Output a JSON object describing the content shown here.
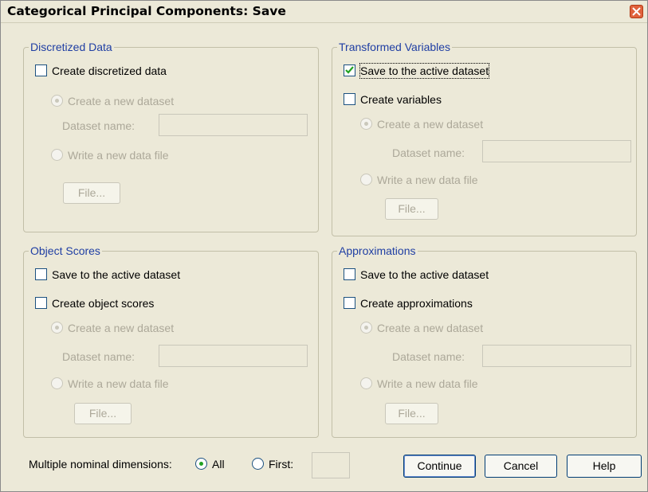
{
  "window": {
    "title": "Categorical Principal Components: Save"
  },
  "discretized": {
    "legend": "Discretized Data",
    "create_label": "Create discretized data",
    "new_dataset_label": "Create a new dataset",
    "dataset_name_label": "Dataset name:",
    "dataset_name_value": "",
    "write_file_label": "Write a new data file",
    "file_button": "File..."
  },
  "transformed": {
    "legend": "Transformed Variables",
    "save_active_label": "Save to the active dataset",
    "create_label": "Create variables",
    "new_dataset_label": "Create a new dataset",
    "dataset_name_label": "Dataset name:",
    "dataset_name_value": "",
    "write_file_label": "Write a new data file",
    "file_button": "File..."
  },
  "object_scores": {
    "legend": "Object Scores",
    "save_active_label": "Save to the active dataset",
    "create_label": "Create object scores",
    "new_dataset_label": "Create a new dataset",
    "dataset_name_label": "Dataset name:",
    "dataset_name_value": "",
    "write_file_label": "Write a new data file",
    "file_button": "File..."
  },
  "approximations": {
    "legend": "Approximations",
    "save_active_label": "Save to the active dataset",
    "create_label": "Create approximations",
    "new_dataset_label": "Create a new dataset",
    "dataset_name_label": "Dataset name:",
    "dataset_name_value": "",
    "write_file_label": "Write a new data file",
    "file_button": "File..."
  },
  "bottom": {
    "multiple_label": "Multiple nominal dimensions:",
    "all_label": "All",
    "first_label": "First:",
    "first_value": "",
    "continue_button": "Continue",
    "cancel_button": "Cancel",
    "help_button": "Help"
  },
  "state": {
    "discretized_checked": false,
    "transformed_save_checked": true,
    "transformed_create_checked": false,
    "object_save_checked": false,
    "object_create_checked": false,
    "approx_save_checked": false,
    "approx_create_checked": false,
    "multiple_selected": "All"
  },
  "colors": {
    "accent_check": "#21a121",
    "legend_text": "#1f3ea3",
    "disabled_text": "#aca899"
  }
}
